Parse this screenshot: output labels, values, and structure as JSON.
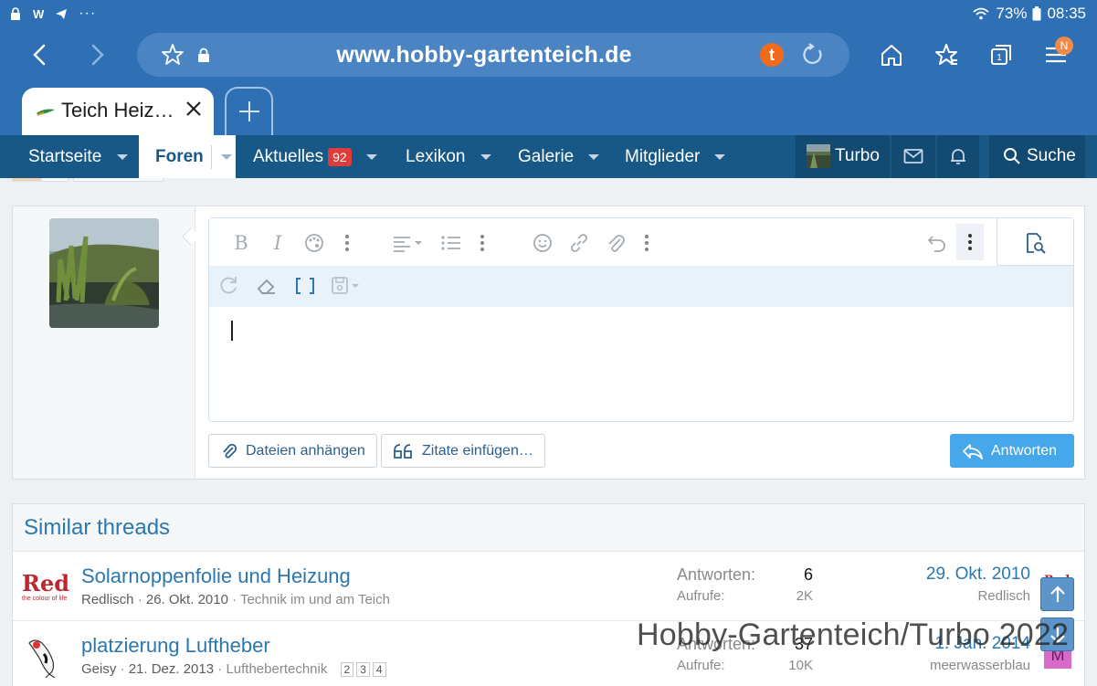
{
  "status_bar": {
    "battery": "73%",
    "time": "08:35"
  },
  "browser": {
    "url": "www.hobby-gartenteich.de",
    "tab_title": "Teich Heiz…",
    "notification_badge": "N"
  },
  "site_nav": {
    "items": [
      {
        "label": "Startseite"
      },
      {
        "label": "Foren"
      },
      {
        "label": "Aktuelles",
        "badge": "92"
      },
      {
        "label": "Lexikon"
      },
      {
        "label": "Galerie"
      },
      {
        "label": "Mitglieder"
      }
    ],
    "user": "Turbo",
    "search_label": "Suche"
  },
  "reply": {
    "attach_label": "Dateien anhängen",
    "quotes_label": "Zitate einfügen…",
    "reply_label": "Antworten"
  },
  "similar_threads": {
    "heading": "Similar threads",
    "replies_label": "Antworten:",
    "views_label": "Aufrufe:",
    "threads": [
      {
        "title": "Solarnoppenfolie und Heizung",
        "author": "Redlisch",
        "date": "26. Okt. 2010",
        "forum": "Technik im und am Teich",
        "replies": "6",
        "views": "2K",
        "last_date": "29. Okt. 2010",
        "last_user": "Redlisch",
        "icon_text": "Red",
        "icon_sub": "the colour of life"
      },
      {
        "title": "platzierung Luftheber",
        "author": "Geisy",
        "date": "21. Dez. 2013",
        "forum": "Lufthebertechnik",
        "pages": [
          "2",
          "3",
          "4"
        ],
        "replies": "37",
        "views": "10K",
        "last_date": "1. Jan. 2014",
        "last_user": "meerwasserblau",
        "last_avatar_letter": "M"
      }
    ]
  },
  "watermark": "Hobby-Gartenteich/Turbo 2022",
  "colors": {
    "browser_blue": "#2f6fb4",
    "site_nav": "#185886",
    "link": "#2b77ae",
    "primary_button": "#47a7eb",
    "badge_red": "#e03b3b"
  }
}
